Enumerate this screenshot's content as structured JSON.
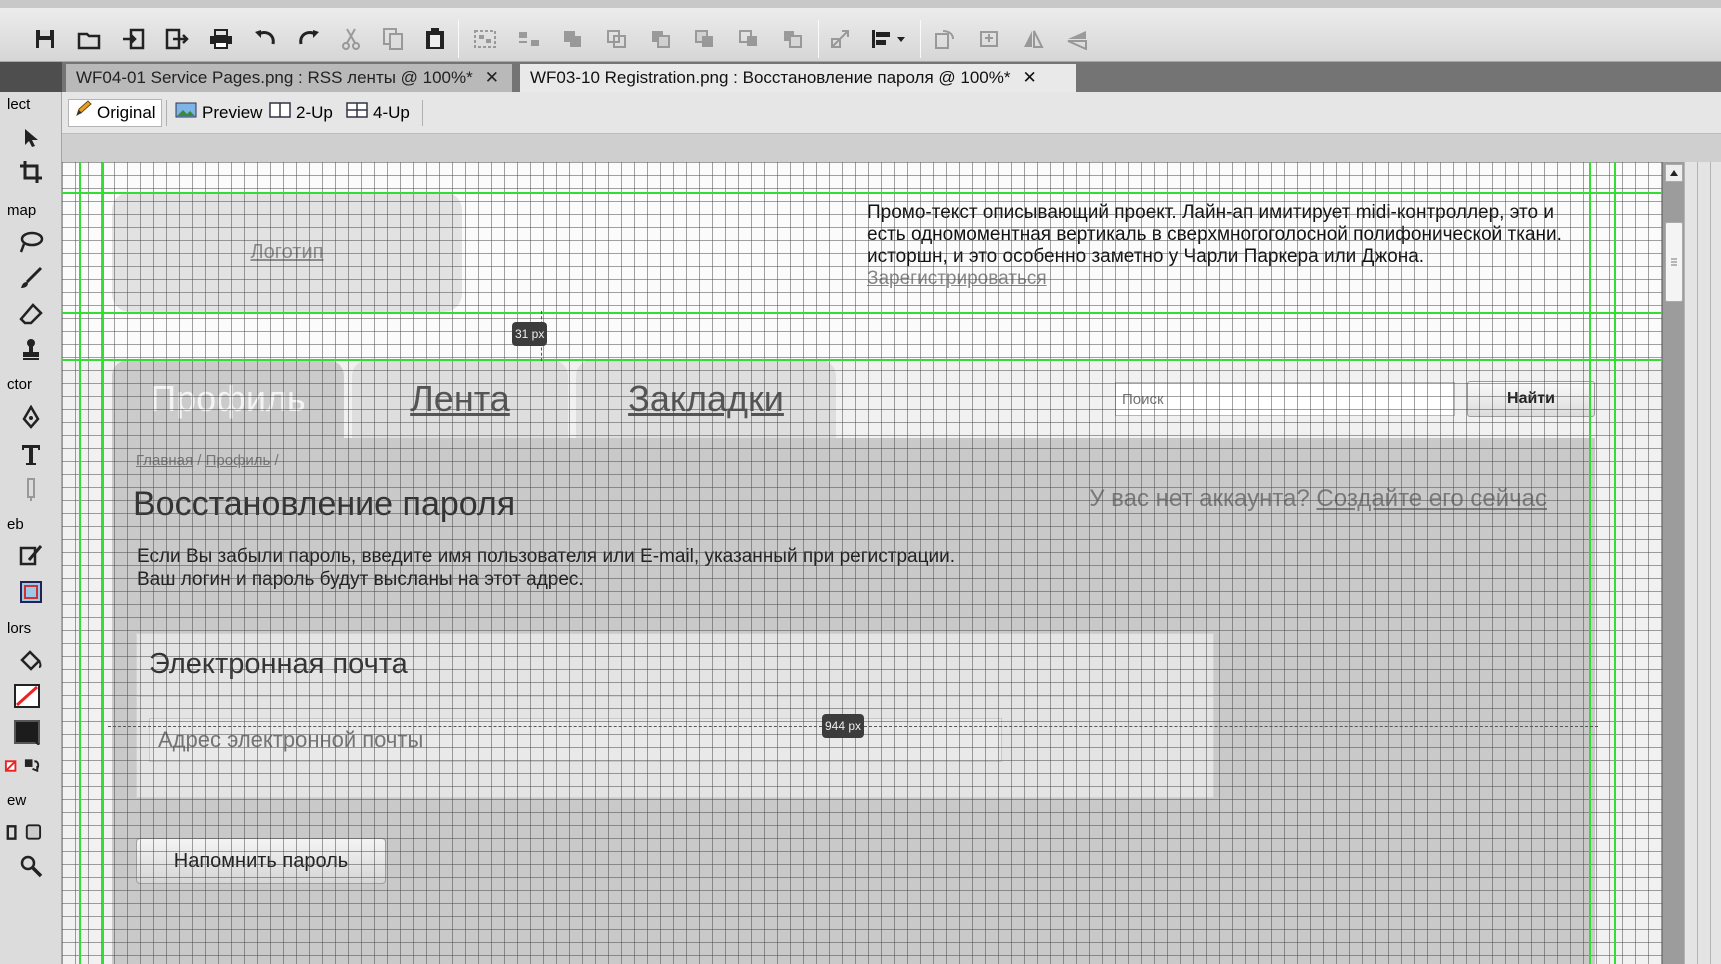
{
  "toolbar": {
    "icons": [
      "save-icon",
      "open-icon",
      "import-icon",
      "export-icon",
      "print-icon",
      "undo-icon",
      "redo-icon",
      "cut-icon",
      "copy-icon",
      "paste-icon",
      "group-icon",
      "align-distribute-icon",
      "union-icon",
      "intersect-icon",
      "punch-icon",
      "crop-shape-icon",
      "bring-forward-icon",
      "send-backward-icon",
      "transform-icon",
      "align-menu-icon",
      "rotate-icon",
      "flip-icon",
      "flip-horizontal-icon",
      "flip-vertical-icon"
    ]
  },
  "tabs": [
    {
      "label": "WF04-01 Service Pages.png : RSS ленты @ 100%*",
      "close": "✕"
    },
    {
      "label": "WF03-10 Registration.png : Восстановление пароля @ 100%*",
      "close": "✕"
    }
  ],
  "tools": {
    "sections": [
      "lect",
      "map",
      "ctor",
      "eb",
      "lors",
      "ew"
    ]
  },
  "viewbar": {
    "original": "Original",
    "preview": "Preview",
    "two_up": "2-Up",
    "four_up": "4-Up"
  },
  "page": {
    "logo": "Логотип",
    "promo_text": "Промо-текст описывающий проект. Лайн-ап имитирует midi-контроллер, это и есть одномоментная вертикаль в сверхмногоголосной полифонической ткани. исторшн, и это особенно заметно у Чарли Паркера или Джона.",
    "promo_link": "Зарегистрироваться",
    "nav": [
      "Профиль",
      "Лента",
      "Закладки"
    ],
    "search_placeholder": "Поиск",
    "search_button": "Найти",
    "breadcrumb": [
      "Главная",
      "Профиль"
    ],
    "breadcrumb_sep": "/",
    "title": "Восстановление пароля",
    "no_account_text": "У вас нет аккаунта?",
    "no_account_link": "Создайте его сейчас",
    "description": "Если Вы забыли пароль, введите имя пользователя или E-mail, указанный при регистрации. Ваш логин и пароль будут высланы на этот адрес.",
    "email_title": "Электронная почта",
    "email_placeholder": "Адрес электронной почты",
    "submit": "Напомнить пароль"
  },
  "measurements": {
    "vertical_label": "31 px",
    "horizontal_label": "944 px"
  },
  "colors": {
    "guide": "#33dd33",
    "grid": "#464646"
  }
}
